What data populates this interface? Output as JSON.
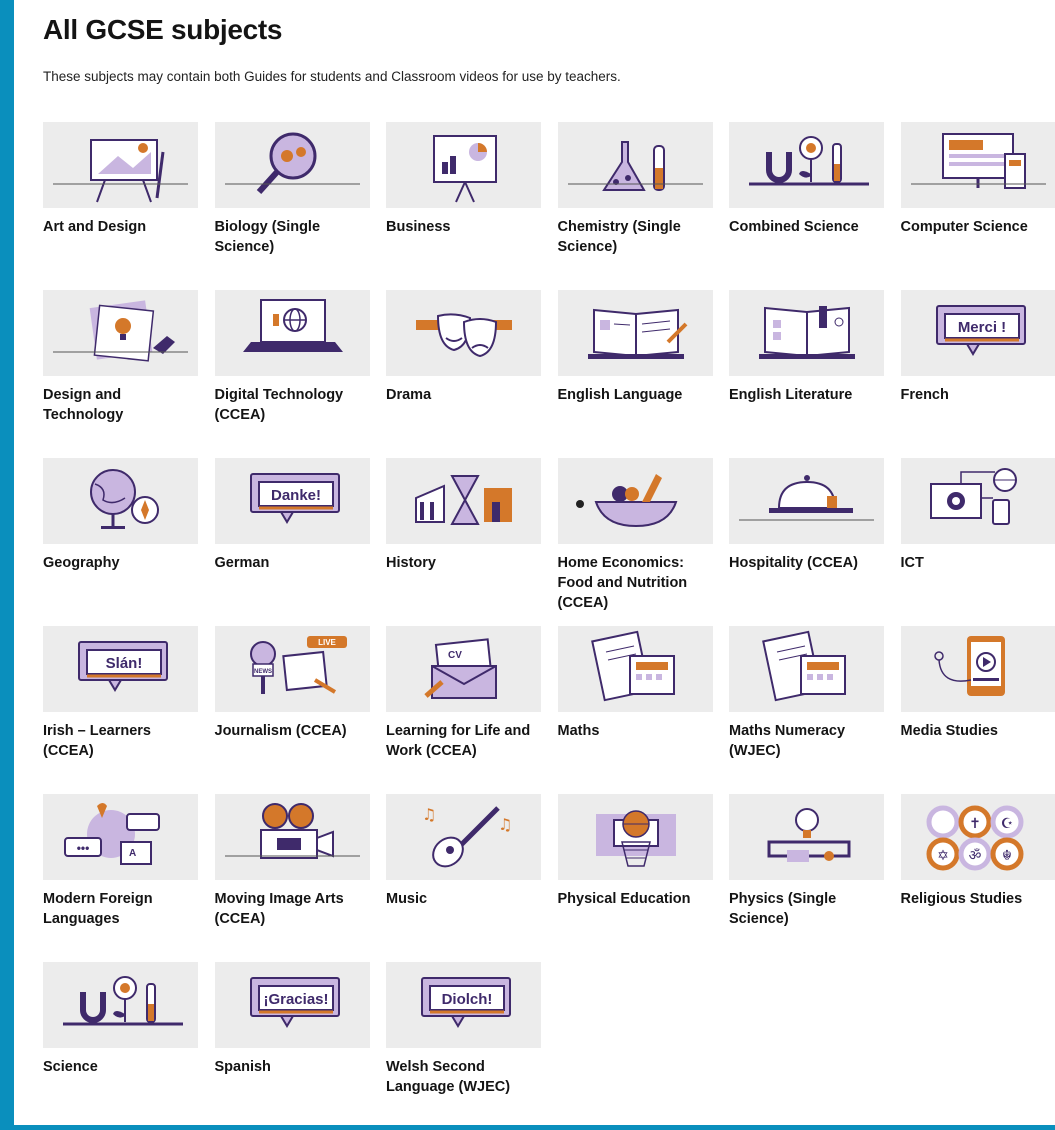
{
  "page": {
    "title": "All GCSE subjects",
    "intro": "These subjects may contain both Guides for students and Classroom videos for use by teachers."
  },
  "colors": {
    "purple": "#3f2a6b",
    "lilac": "#c9b6e0",
    "orange": "#d4782a",
    "tile": "#ececec"
  },
  "subjects": [
    {
      "label": "Art and Design",
      "icon": "easel-icon"
    },
    {
      "label": "Biology (Single Science)",
      "icon": "magnifier-icon"
    },
    {
      "label": "Business",
      "icon": "presentation-board-icon"
    },
    {
      "label": "Chemistry (Single Science)",
      "icon": "flask-icon"
    },
    {
      "label": "Combined Science",
      "icon": "magnet-flower-icon"
    },
    {
      "label": "Computer Science",
      "icon": "monitor-devices-icon"
    },
    {
      "label": "Design and Technology",
      "icon": "drawing-lightbulb-icon"
    },
    {
      "label": "Digital Technology (CCEA)",
      "icon": "laptop-globe-icon"
    },
    {
      "label": "Drama",
      "icon": "theatre-masks-icon"
    },
    {
      "label": "English Language",
      "icon": "open-book-pen-icon"
    },
    {
      "label": "English Literature",
      "icon": "open-book-icon"
    },
    {
      "label": "French",
      "icon": "speech-sign-icon",
      "word": "Merci !"
    },
    {
      "label": "Geography",
      "icon": "globe-compass-icon"
    },
    {
      "label": "German",
      "icon": "speech-sign-icon",
      "word": "Danke!"
    },
    {
      "label": "History",
      "icon": "hourglass-buildings-icon"
    },
    {
      "label": "Home Economics: Food and Nutrition (CCEA)",
      "icon": "food-bowl-icon"
    },
    {
      "label": "Hospitality (CCEA)",
      "icon": "cloche-icon"
    },
    {
      "label": "ICT",
      "icon": "network-devices-icon"
    },
    {
      "label": "Irish – Learners (CCEA)",
      "icon": "speech-sign-icon",
      "word": "Slán!"
    },
    {
      "label": "Journalism (CCEA)",
      "icon": "news-microphone-icon",
      "badge1": "LIVE",
      "badge2": "NEWS"
    },
    {
      "label": "Learning for Life and Work (CCEA)",
      "icon": "cv-envelope-icon",
      "word": "CV"
    },
    {
      "label": "Maths",
      "icon": "calculator-paper-icon"
    },
    {
      "label": "Maths Numeracy (WJEC)",
      "icon": "calculator-paper-icon"
    },
    {
      "label": "Media Studies",
      "icon": "phone-play-icon"
    },
    {
      "label": "Modern Foreign Languages",
      "icon": "globe-chat-icon",
      "word": "A"
    },
    {
      "label": "Moving Image Arts (CCEA)",
      "icon": "film-camera-icon"
    },
    {
      "label": "Music",
      "icon": "guitar-notes-icon"
    },
    {
      "label": "Physical Education",
      "icon": "basketball-hoop-icon"
    },
    {
      "label": "Physics (Single Science)",
      "icon": "bulb-circuit-icon"
    },
    {
      "label": "Religious Studies",
      "icon": "faith-symbols-icon"
    },
    {
      "label": "Science",
      "icon": "magnet-flower-icon"
    },
    {
      "label": "Spanish",
      "icon": "speech-sign-icon",
      "word": "¡Gracias!"
    },
    {
      "label": "Welsh Second Language (WJEC)",
      "icon": "speech-sign-icon",
      "word": "Diolch!"
    }
  ]
}
